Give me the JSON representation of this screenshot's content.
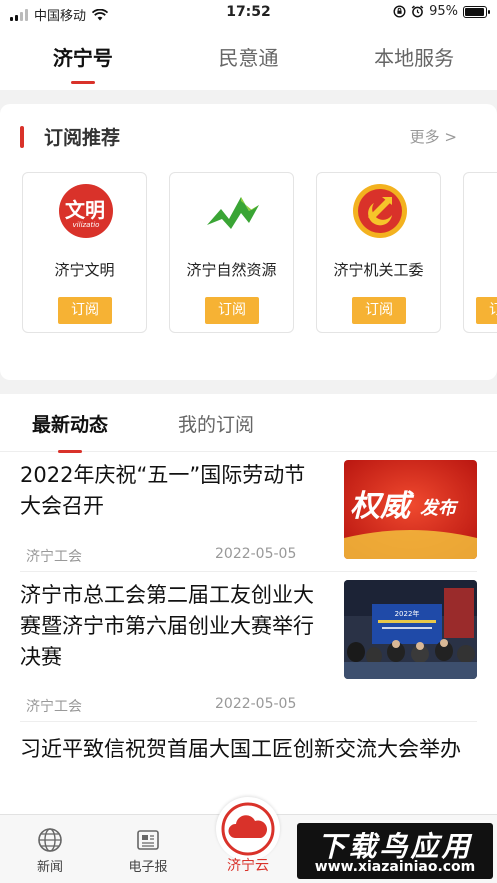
{
  "status_bar": {
    "carrier": "中国移动",
    "time": "17:52",
    "battery": "95%",
    "battery_level": 0.95
  },
  "top_tabs": [
    {
      "label": "济宁号",
      "active": true
    },
    {
      "label": "民意通",
      "active": false
    },
    {
      "label": "本地服务",
      "active": false
    }
  ],
  "subscribe": {
    "title": "订阅推荐",
    "more": "更多 >",
    "button_label": "订阅",
    "items": [
      {
        "name": "济宁文明",
        "logo_text": "文明",
        "logo_sub": "vilizatio",
        "icon": "wenming-logo"
      },
      {
        "name": "济宁自然资源",
        "icon": "nature-resources-logo"
      },
      {
        "name": "济宁机关工委",
        "icon": "party-emblem-logo"
      }
    ]
  },
  "feed": {
    "tabs": [
      {
        "label": "最新动态",
        "active": true
      },
      {
        "label": "我的订阅",
        "active": false
      }
    ],
    "articles": [
      {
        "title": "2022年庆祝“五一”国际劳动节大会召开",
        "source": "济宁工会",
        "date": "2022-05-05",
        "thumb_text_1": "权威",
        "thumb_text_2": "发布"
      },
      {
        "title": "济宁市总工会第二届工友创业大赛暨济宁市第六届创业大赛举行决赛",
        "source": "济宁工会",
        "date": "2022-05-05",
        "thumb_screen_text": "2022年"
      },
      {
        "title": "习近平致信祝贺首届大国工匠创新交流大会举办"
      }
    ]
  },
  "bottom_nav": {
    "items": [
      {
        "label": "新闻",
        "icon": "globe-icon"
      },
      {
        "label": "电子报",
        "icon": "newspaper-icon"
      },
      {
        "label": "济宁云",
        "icon": "cloud-icon",
        "active": true
      }
    ]
  },
  "watermark": {
    "title": "下载鸟应用",
    "url": "www.xiazainiao.com"
  },
  "colors": {
    "accent": "#d9322a",
    "subscribe_button": "#f6b234",
    "background": "#f2f2f2"
  }
}
